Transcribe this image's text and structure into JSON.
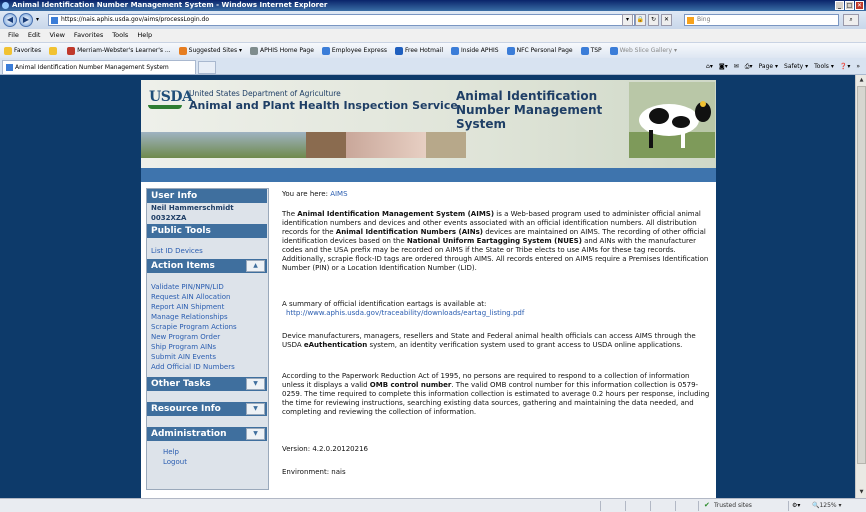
{
  "window": {
    "title": "Animal Identification Number Management System - Windows Internet Explorer"
  },
  "address": {
    "url": "https://nais.aphis.usda.gov/aims/processLogin.do"
  },
  "search": {
    "placeholder": "Bing"
  },
  "menu": [
    "File",
    "Edit",
    "View",
    "Favorites",
    "Tools",
    "Help"
  ],
  "favorites": {
    "label": "Favorites",
    "items": [
      "Merriam-Webster's Learner's ...",
      "Suggested Sites ▾",
      "APHIS Home Page",
      "Employee Express",
      "Free Hotmail",
      "Inside APHIS",
      "NFC Personal Page",
      "TSP",
      "Web Slice Gallery ▾"
    ]
  },
  "tab": {
    "title": "Animal Identification Number Management System"
  },
  "command_bar": [
    "Page ▾",
    "Safety ▾",
    "Tools ▾",
    "»"
  ],
  "banner": {
    "usda": "USDA",
    "dept": "United States Department of Agriculture",
    "agency": "Animal and Plant Health Inspection Service",
    "system": "Animal Identification Number Management System"
  },
  "sidebar": {
    "user_info": {
      "title": "User Info",
      "name": "Neil Hammerschmidt",
      "id": "0032XZA"
    },
    "public_tools": {
      "title": "Public Tools",
      "items": [
        "List ID Devices"
      ]
    },
    "action_items": {
      "title": "Action Items",
      "items": [
        "Validate PIN/NPN/LID",
        "Request AIN Allocation",
        "Report AIN Shipment",
        "Manage Relationships",
        "Scrapie Program Actions",
        "New Program Order",
        "Ship Program AINs",
        "Submit AIN Events",
        "Add Official ID Numbers"
      ]
    },
    "other_tasks": {
      "title": "Other Tasks"
    },
    "resource_info": {
      "title": "Resource Info"
    },
    "administration": {
      "title": "Administration",
      "items": [
        "Help",
        "Logout"
      ]
    }
  },
  "content": {
    "breadcrumb_prefix": "You are here:",
    "breadcrumb_link": "AIMS",
    "p1": {
      "a": "The ",
      "b": "Animal Identification Management System (AIMS)",
      "c": " is a Web-based program used to administer official animal identification numbers and devices and other events associated with an official identification numbers. All distribution records for the ",
      "d": "Animal Identification Numbers (AINs)",
      "e": " devices are maintained on AIMS. The recording of other official identification devices based on the ",
      "f": "National Uniform Eartagging System (NUES)",
      "g": " and AINs with the manufacturer codes and the USA prefix may be recorded on AIMS if the State or Tribe elects to use AIMs for these tag records. Additionally, scrapie flock-ID tags are ordered through AIMS. All records entered on AIMS require a Premises Identification Number (PIN) or a Location Identification Number (LID)."
    },
    "p2": {
      "text": "A summary of official identification eartags is available at:",
      "link": "http://www.aphis.usda.gov/traceability/downloads/eartag_listing.pdf"
    },
    "p3": {
      "a": "Device manufacturers, managers, resellers and State and Federal animal health officials can access AIMS through the USDA ",
      "b": "eAuthentication",
      "c": " system, an identity verification system used to grant access to USDA online applications."
    },
    "p4": {
      "a": "According to the Paperwork Reduction Act of 1995, no persons are required to respond to a collection of information unless it displays a valid ",
      "b": "OMB control number",
      "c": ". The valid OMB control number for this information collection is 0579-0259. The time required to complete this information collection is estimated to average 0.2 hours per response, including the time for reviewing instructions, searching existing data sources, gathering and maintaining the data needed, and completing and reviewing the collection of information."
    },
    "version": "Version: 4.2.0.20120216",
    "environment": "Environment: nais"
  },
  "status": {
    "zone": "Trusted sites",
    "zoom": "125%"
  },
  "colors": {
    "nav_blue": "#3f6f9e",
    "link": "#2a5db0",
    "page_bg": "#0d3a6a"
  }
}
